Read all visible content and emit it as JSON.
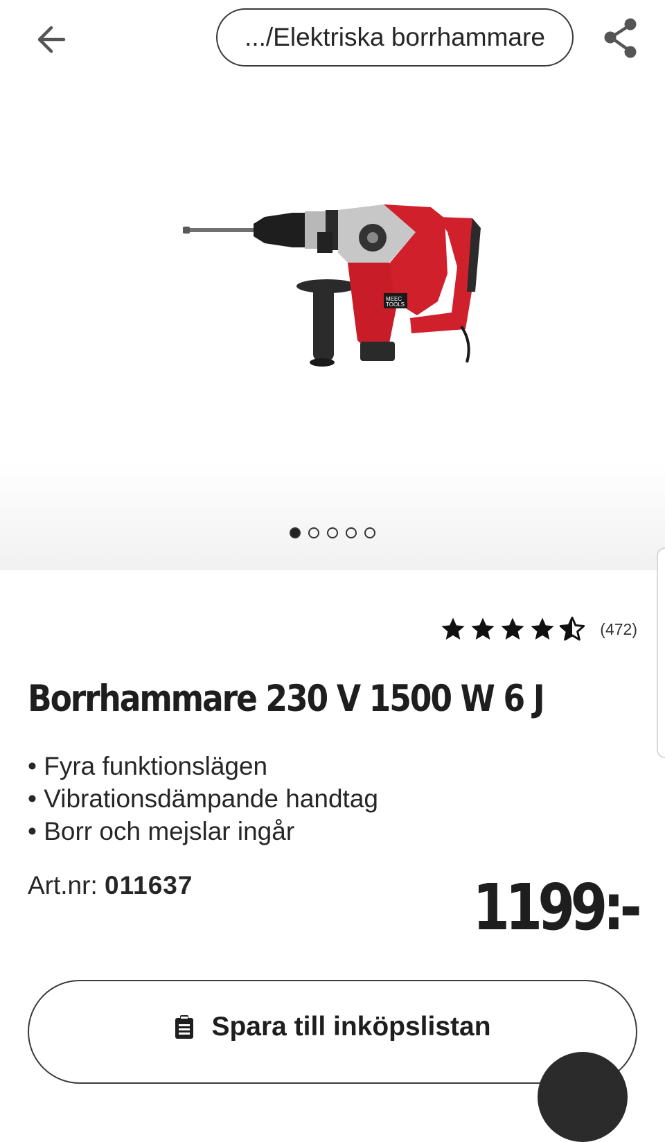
{
  "header": {
    "back_icon": "arrow-left-icon",
    "breadcrumb": ".../Elektriska borrhammare",
    "share_icon": "share-icon"
  },
  "gallery": {
    "image_icon": "hammer-drill-product-image",
    "image_count": 5,
    "active_index": 0
  },
  "rating": {
    "stars": 4.5,
    "max_stars": 5,
    "count_label": "(472)"
  },
  "product": {
    "title": "Borrhammare 230 V 1500 W 6 J",
    "features": [
      "Fyra funktionslägen",
      "Vibrationsdämpande handtag",
      "Borr och mejslar ingår"
    ],
    "art_label": "Art.nr:",
    "art_number": "011637",
    "price": "1199:-"
  },
  "actions": {
    "save_icon": "clipboard-list-icon",
    "save_label": "Spara till inköpslistan"
  },
  "colors": {
    "text": "#1e1e1e",
    "product_red": "#d0202c"
  }
}
